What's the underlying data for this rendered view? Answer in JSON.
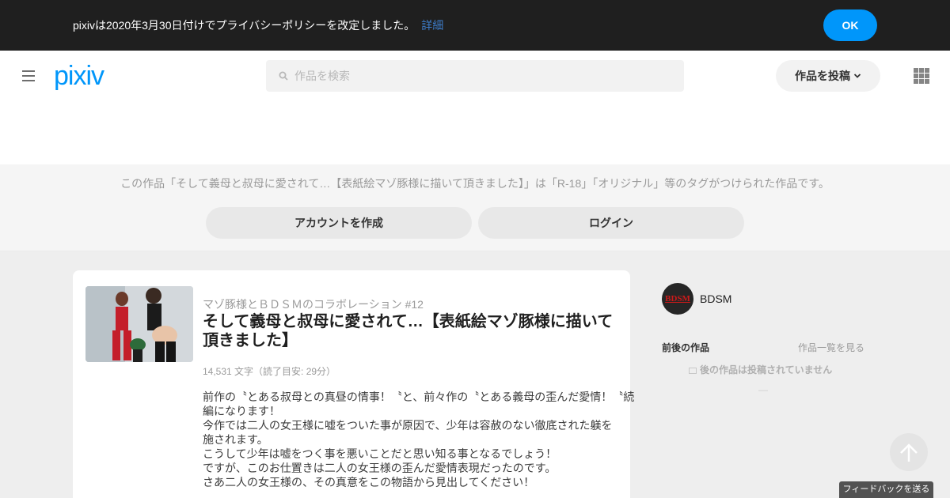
{
  "notice": {
    "text": "pixivは2020年3月30日付けでプライバシーポリシーを改定しました。",
    "link": "詳細",
    "ok": "OK"
  },
  "header": {
    "logo": "pixiv",
    "search_placeholder": "作品を検索",
    "post_label": "作品を投稿"
  },
  "tag_area": {
    "description": "この作品「そして義母と叔母に愛されて…【表紙絵マゾ豚様に描いて頂きました】」は「R-18」「オリジナル」等のタグがつけられた作品です。",
    "create_account": "アカウントを作成",
    "login": "ログイン"
  },
  "work": {
    "series": "マゾ豚様とＢＤＳＭのコラボレーション #12",
    "title": "そして義母と叔母に愛されて…【表紙絵マゾ豚様に描いて頂きました】",
    "meta": "14,531 文字（読了目安: 29分）",
    "caption": [
      "前作の〝とある叔母との真昼の情事！〝と、前々作の〝とある義母の歪んだ愛情！〝続",
      "編になります！",
      "今作では二人の女王様に嘘をついた事が原因で、少年は容赦のない徹底された躾を",
      "施されます。",
      "こうして少年は嘘をつく事を悪いことだと思い知る事となるでしょう！",
      "ですが、このお仕置きは二人の女王様の歪んだ愛情表現だったのです。",
      "さあ二人の女王様の、その真意をこの物語から見出してください！"
    ]
  },
  "sidebar": {
    "avatar_text": "BDSM",
    "author": "BDSM",
    "nav_label": "前後の作品",
    "list_link": "作品一覧を見る",
    "no_next": "後の作品は投稿されていません",
    "dash": "—"
  },
  "feedback": "フィードバックを送る",
  "colors": {
    "accent": "#0096fa",
    "notice_bg": "#1f1f1f"
  }
}
